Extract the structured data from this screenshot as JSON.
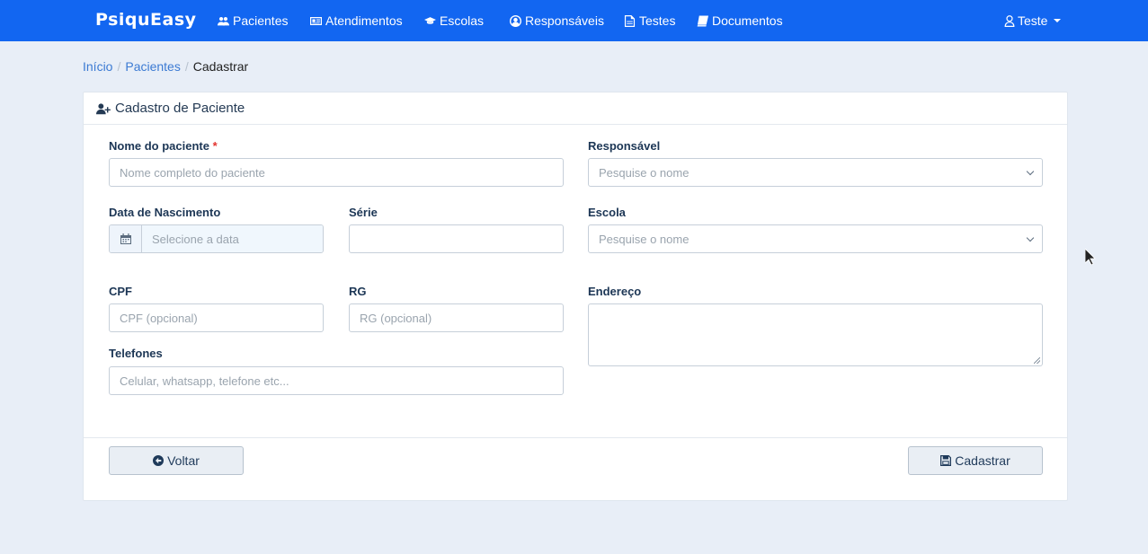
{
  "nav": {
    "brand": "PsiquEasy",
    "items": [
      {
        "label": "Pacientes",
        "icon": "users-icon"
      },
      {
        "label": "Atendimentos",
        "icon": "id-card-icon"
      },
      {
        "label": "Escolas",
        "icon": "graduation-cap-icon"
      },
      {
        "label": "Responsáveis",
        "icon": "user-circle-icon"
      },
      {
        "label": "Testes",
        "icon": "file-icon"
      },
      {
        "label": "Documentos",
        "icon": "book-icon"
      }
    ],
    "user": "Teste"
  },
  "breadcrumb": {
    "items": [
      "Início",
      "Pacientes"
    ],
    "current": "Cadastrar"
  },
  "card": {
    "title": "Cadastro de Paciente"
  },
  "form": {
    "nome": {
      "label": "Nome do paciente",
      "required_mark": "*",
      "placeholder": "Nome completo do paciente"
    },
    "responsavel": {
      "label": "Responsável",
      "placeholder": "Pesquise o nome"
    },
    "nascimento": {
      "label": "Data de Nascimento",
      "placeholder": "Selecione a data"
    },
    "serie": {
      "label": "Série",
      "value": ""
    },
    "escola": {
      "label": "Escola",
      "placeholder": "Pesquise o nome"
    },
    "cpf": {
      "label": "CPF",
      "placeholder": "CPF (opcional)"
    },
    "rg": {
      "label": "RG",
      "placeholder": "RG (opcional)"
    },
    "endereco": {
      "label": "Endereço",
      "value": ""
    },
    "telefones": {
      "label": "Telefones",
      "placeholder": "Celular, whatsapp, telefone etc..."
    }
  },
  "buttons": {
    "back": "Voltar",
    "submit": "Cadastrar"
  },
  "colors": {
    "navbar": "#1266f1",
    "background": "#e8eef7",
    "required": "#e3342f"
  }
}
